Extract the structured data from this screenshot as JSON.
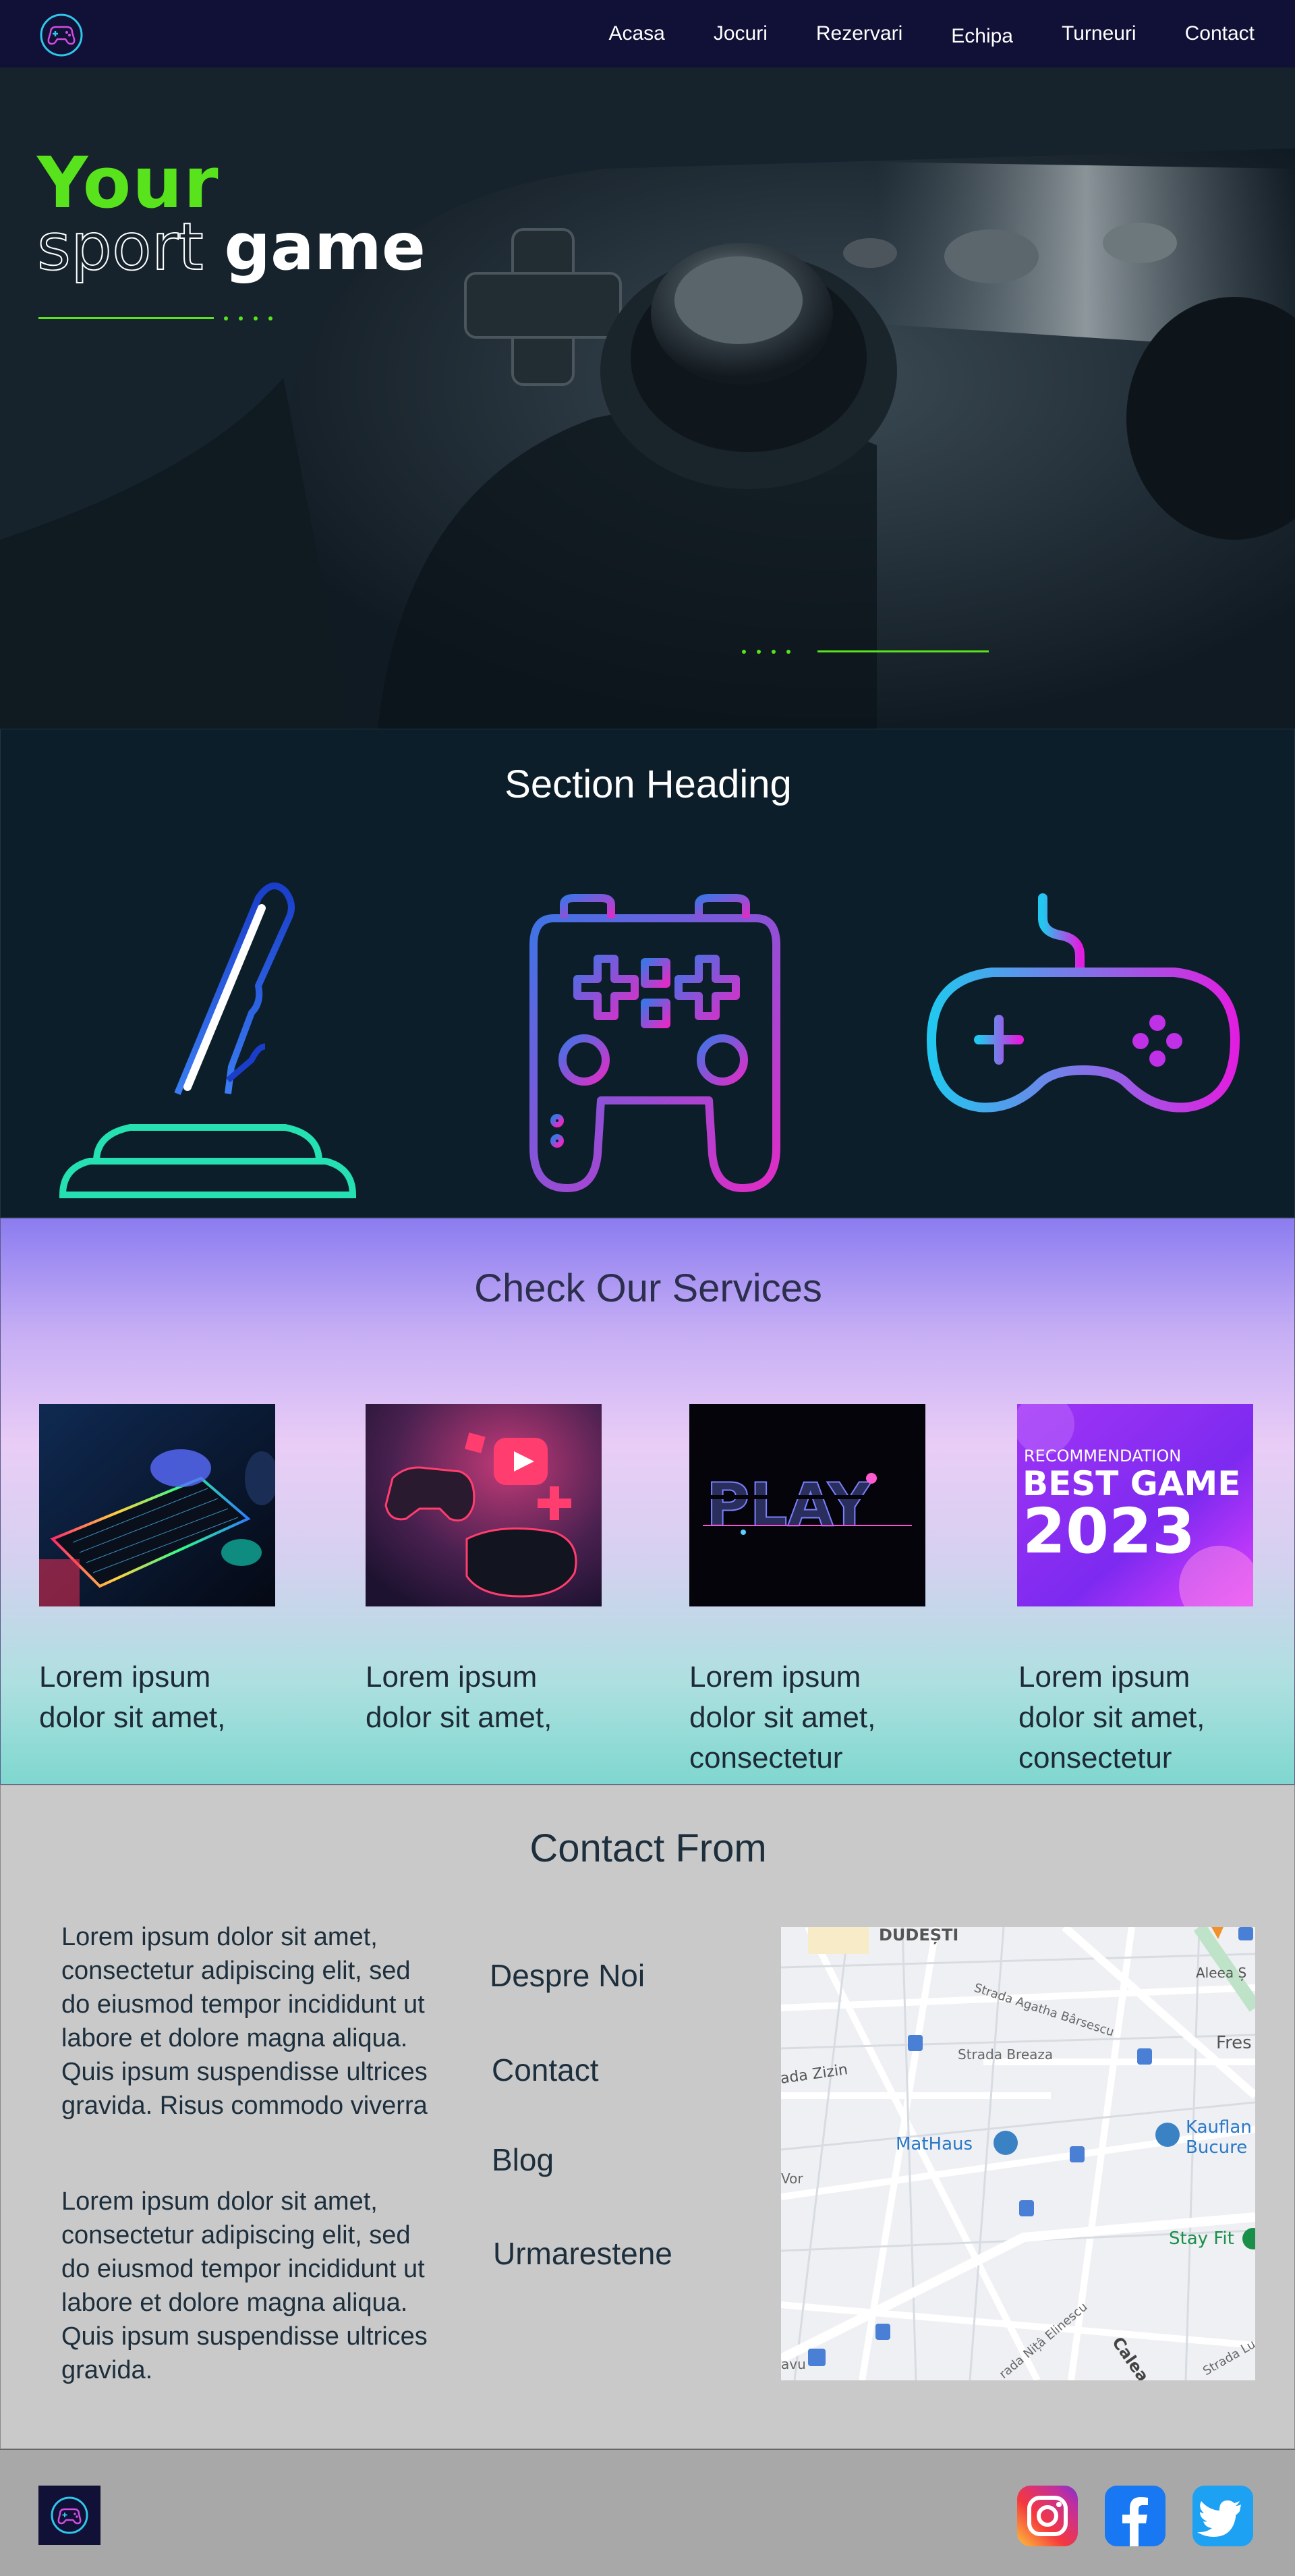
{
  "nav": {
    "logo_icon": "gamepad-circle-logo",
    "items": [
      "Acasa",
      "Jocuri",
      "Rezervari",
      "Echipa",
      "Turneuri",
      "Contact"
    ]
  },
  "hero": {
    "line1": "Your",
    "line2a": "sport",
    "line2b": "game",
    "accent": "#58e31c"
  },
  "features": {
    "heading": "Section Heading",
    "icons": [
      "joystick-icon",
      "gamepad-outline-icon",
      "controller-icon"
    ]
  },
  "services": {
    "heading": "Check Our Services",
    "cards": [
      {
        "image": "keyboard-setup-image",
        "text": "Lorem ipsum dolor sit amet,"
      },
      {
        "image": "gaming-3d-image",
        "text": "Lorem ipsum dolor sit amet,"
      },
      {
        "image": "play-neon-image",
        "text": "Lorem ipsum dolor sit amet, consectetur"
      },
      {
        "image": "best-game-2023-image",
        "text": "Lorem ipsum dolor sit amet, consectetur",
        "banner_small": "RECOMMENDATION",
        "banner_big": "BEST GAME",
        "banner_year": "2023"
      }
    ]
  },
  "contact": {
    "heading": "Contact From",
    "paragraph1": "Lorem ipsum dolor sit amet, consectetur adipiscing elit, sed do eiusmod tempor incididunt ut labore et dolore magna aliqua. Quis ipsum suspendisse ultrices gravida. Risus commodo viverra",
    "paragraph2": "Lorem ipsum dolor sit amet, consectetur adipiscing elit, sed do eiusmod tempor incididunt ut labore et dolore magna aliqua. Quis ipsum suspendisse ultrices gravida.",
    "links": [
      "Despre Noi",
      "Contact",
      "Blog",
      "Urmarestene"
    ],
    "map_labels": {
      "district": "DUDEȘTI",
      "s1": "Strada Agatha Bârsescu",
      "s2": "Strada Breaza",
      "s3": "ada Zizin",
      "poi1": "MatHaus",
      "poi2": "Kauflan",
      "poi2b": "Bucure",
      "poi3": "Stay Fit",
      "s4": "Calea Vitan",
      "s5": "rada Nițâ Elinescu",
      "s6": "Aleea Ș",
      "s7": "Fres",
      "s8": "Vor",
      "s9": "Strada Lu",
      "s10": "avu"
    }
  },
  "footer": {
    "logo_icon": "gamepad-circle-logo",
    "social": [
      "instagram-icon",
      "facebook-icon",
      "twitter-icon"
    ]
  }
}
